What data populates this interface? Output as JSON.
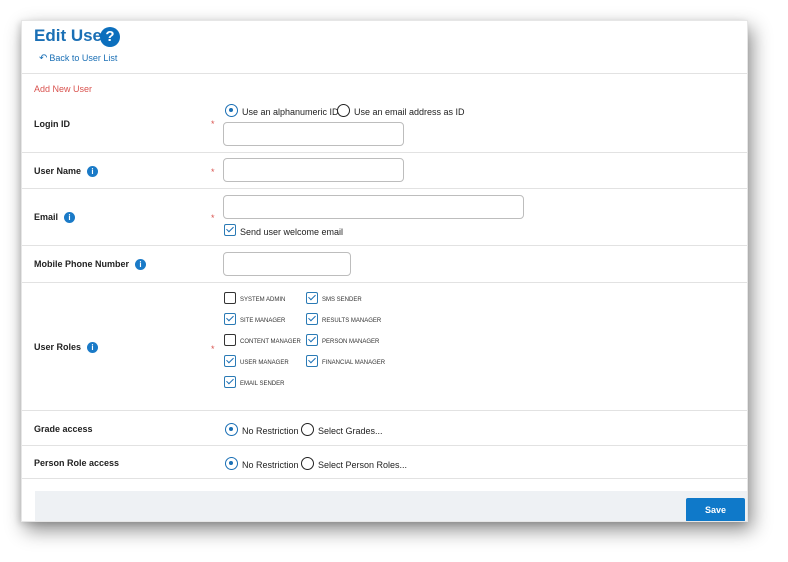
{
  "header": {
    "title": "Edit User",
    "help_icon": "question-circle-icon",
    "back_label": "Back to User List"
  },
  "section_title": "Add New User",
  "required_mark": "*",
  "login": {
    "label": "Login ID",
    "options": [
      "Use an alphanumeric ID",
      "Use an email address as ID"
    ],
    "selected": 0,
    "value": ""
  },
  "username": {
    "label": "User Name",
    "value": ""
  },
  "email": {
    "label": "Email",
    "value": "",
    "welcome_label": "Send user welcome email",
    "welcome_checked": true
  },
  "mobile": {
    "label": "Mobile Phone Number",
    "value": ""
  },
  "roles": {
    "label": "User Roles",
    "items": [
      {
        "name": "SYSTEM ADMIN",
        "checked": false
      },
      {
        "name": "SMS SENDER",
        "checked": true
      },
      {
        "name": "SITE MANAGER",
        "checked": true
      },
      {
        "name": "RESULTS MANAGER",
        "checked": true
      },
      {
        "name": "CONTENT MANAGER",
        "checked": false
      },
      {
        "name": "PERSON MANAGER",
        "checked": true
      },
      {
        "name": "USER MANAGER",
        "checked": true
      },
      {
        "name": "FINANCIAL MANAGER",
        "checked": true
      },
      {
        "name": "EMAIL SENDER",
        "checked": true
      }
    ]
  },
  "grade": {
    "label": "Grade access",
    "options": [
      "No Restriction",
      "Select Grades..."
    ],
    "selected": 0
  },
  "person_role": {
    "label": "Person Role access",
    "options": [
      "No Restriction",
      "Select Person Roles..."
    ],
    "selected": 0
  },
  "save_label": "Save",
  "colors": {
    "accent": "#1a6fb5",
    "required": "#d9534f",
    "button": "#0f79c9"
  }
}
